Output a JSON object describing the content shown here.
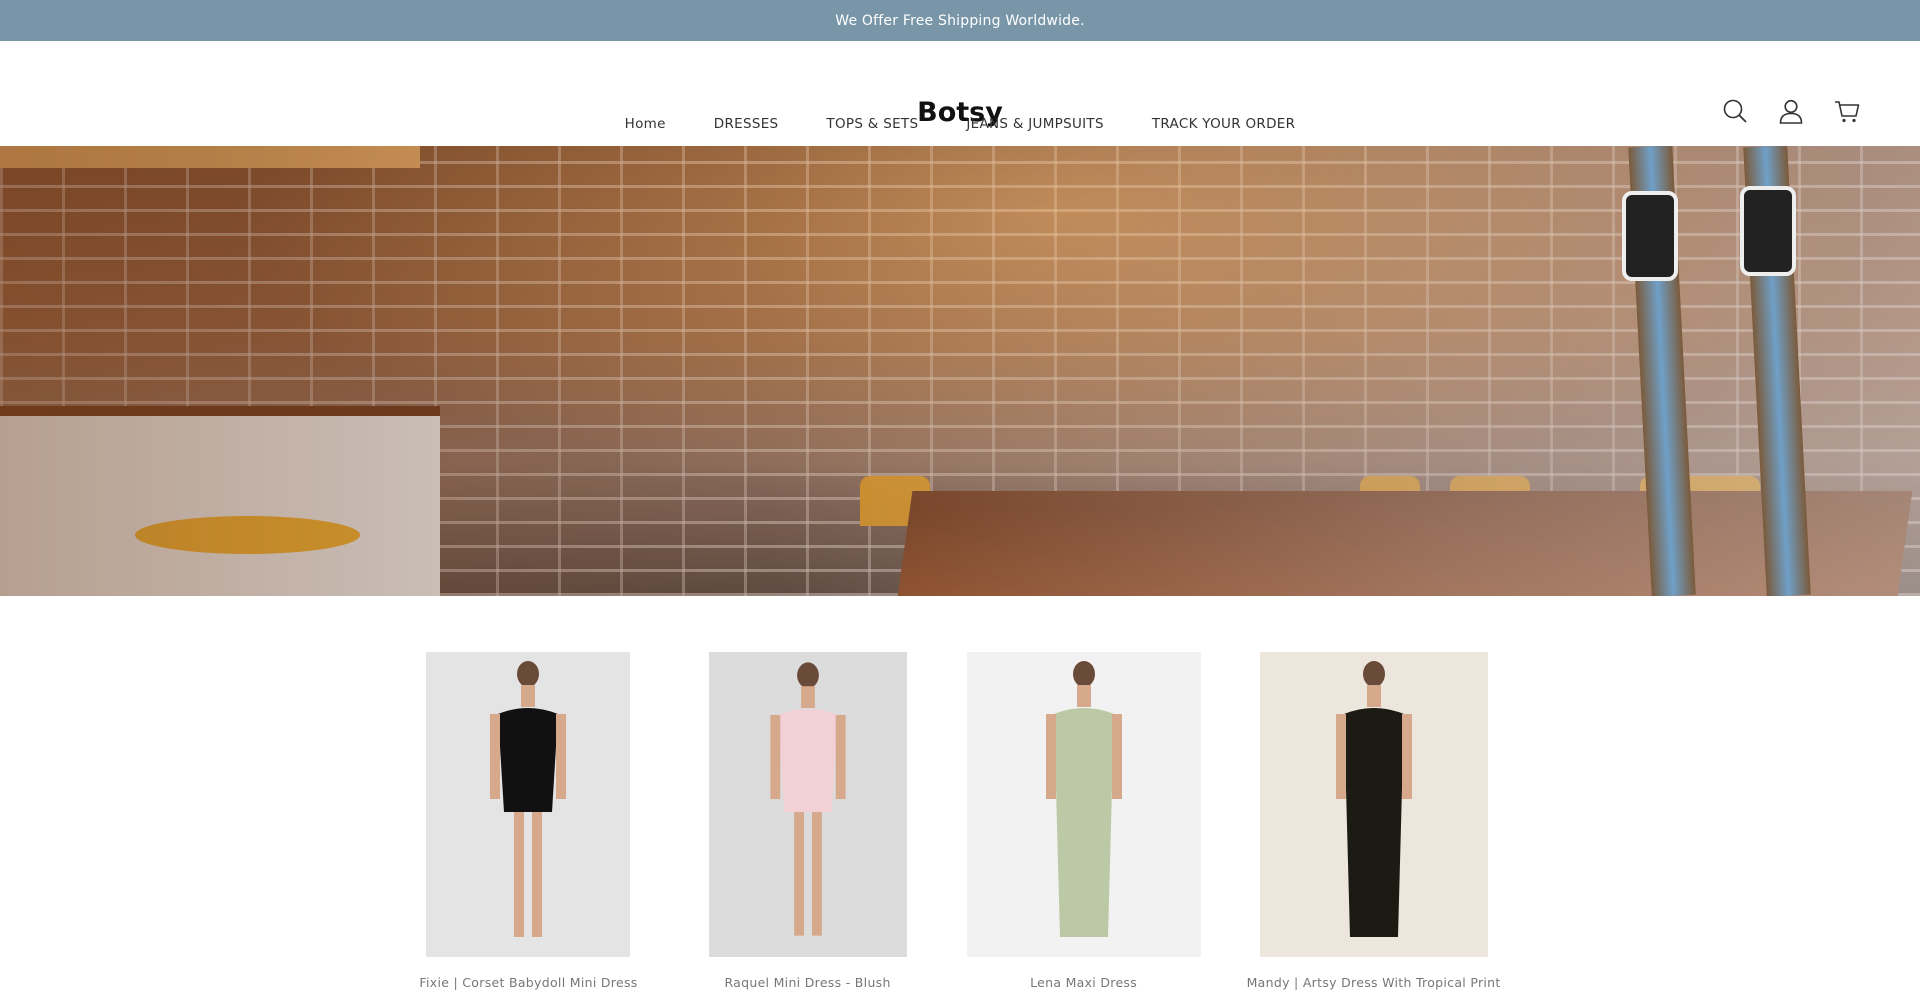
{
  "announcement": "We Offer Free Shipping Worldwide.",
  "brand": "Botsy",
  "header_icons": [
    "search-icon",
    "account-icon",
    "cart-icon"
  ],
  "nav": [
    {
      "label": "Home"
    },
    {
      "label": "DRESSES"
    },
    {
      "label": "TOPS & SETS"
    },
    {
      "label": "JEANS & JUMPSUITS"
    },
    {
      "label": "TRACK YOUR ORDER"
    }
  ],
  "products": [
    {
      "name": "Fixie | Corset Babydoll Mini Dress",
      "dress_color": "#111111",
      "bg": "#e4e4e4"
    },
    {
      "name": "Raquel Mini Dress - Blush",
      "dress_color": "#f3cfd6",
      "bg": "#dcdcdc"
    },
    {
      "name": "Lena Maxi Dress",
      "dress_color": "#bcc9a6",
      "bg": "#f2f2f2"
    },
    {
      "name": "Mandy | Artsy Dress With Tropical Print",
      "dress_color": "#1b1b14",
      "bg": "#ece6dc"
    }
  ],
  "colors": {
    "announcement_bg": "#7896a8"
  }
}
